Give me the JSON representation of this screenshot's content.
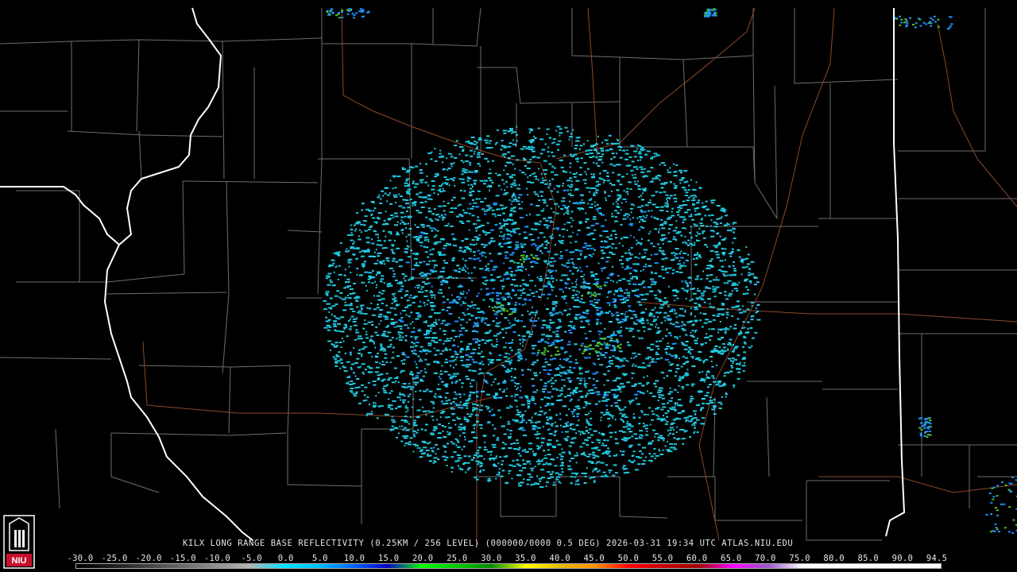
{
  "product": {
    "caption": "KILX LONG RANGE BASE REFLECTIVITY (0.25KM / 256 LEVEL) (000000/0000 0.5 DEG) 2026-03-31 19:34 UTC  ATLAS.NIU.EDU"
  },
  "color_scale": {
    "labels": [
      "-30.0",
      "-25.0",
      "-20.0",
      "-15.0",
      "-10.0",
      "-5.0",
      "0.0",
      "5.0",
      "10.0",
      "15.0",
      "20.0",
      "25.0",
      "30.0",
      "35.0",
      "40.0",
      "45.0",
      "50.0",
      "55.0",
      "60.0",
      "65.0",
      "70.0",
      "75.0",
      "80.0",
      "85.0",
      "90.0",
      "94.5"
    ],
    "stops": [
      "#000000",
      "#1a1a1a",
      "#404040",
      "#666666",
      "#8c8c8c",
      "#b3b3b3",
      "#00e5ff",
      "#00bfff",
      "#0066ff",
      "#0000c8",
      "#00ff00",
      "#00c800",
      "#008c00",
      "#ffff00",
      "#e6b800",
      "#ff9000",
      "#ff0000",
      "#c80000",
      "#a00000",
      "#ff00ff",
      "#9955c9",
      "#ffffff",
      "#ffffff",
      "#ffffff",
      "#ffffff",
      "#ffffff"
    ]
  },
  "logo": {
    "text": "NIU",
    "color": "#c8102e"
  },
  "colors": {
    "background": "#000000",
    "county_lines": "#6e6e6e",
    "state_lines": "#ffffff",
    "highways": "#8b4a2b",
    "echo_light": "#1fc8e0",
    "echo_mid": "#1e90ff",
    "echo_strong": "#2f5fd0",
    "echo_green": "#4fbf2a"
  },
  "radar": {
    "site": "KILX",
    "echo_coverage": "circular ground clutter / clear-air return around radar site"
  }
}
